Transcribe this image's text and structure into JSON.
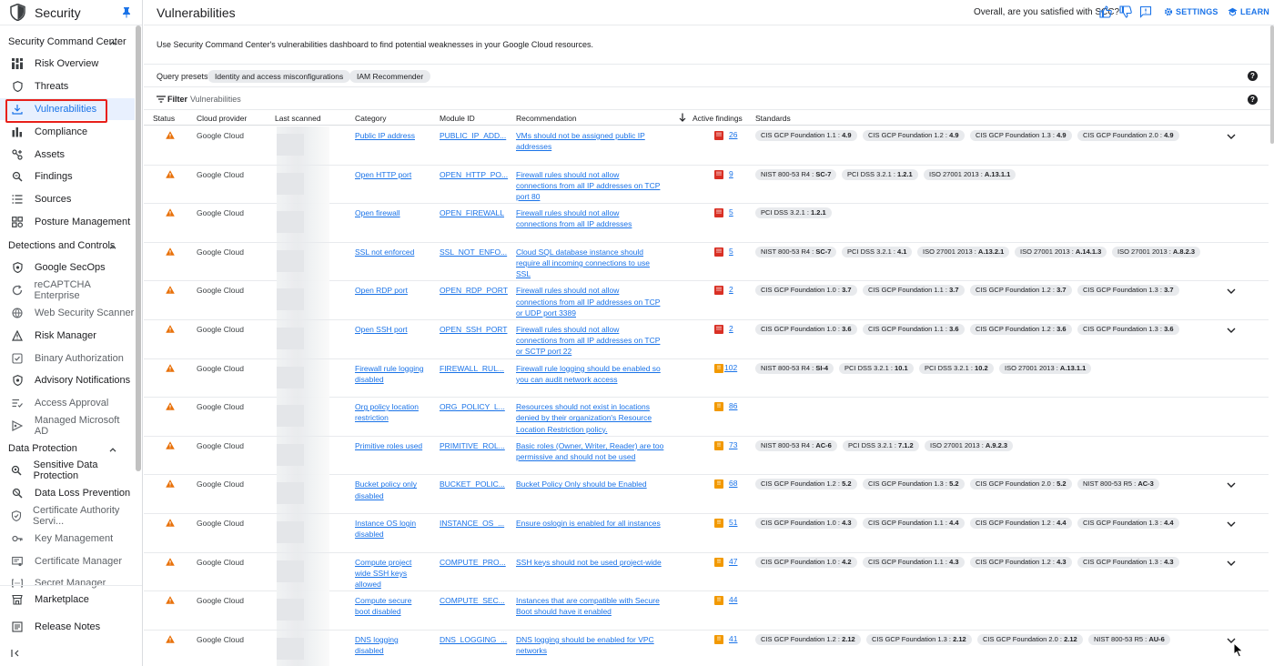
{
  "sidebar": {
    "title": "Security",
    "sections": [
      {
        "label": "Security Command Center",
        "items": [
          {
            "label": "Risk Overview",
            "icon": "grid-icon",
            "dim": false
          },
          {
            "label": "Threats",
            "icon": "shield-outline-icon",
            "dim": false
          },
          {
            "label": "Vulnerabilities",
            "icon": "download-icon",
            "dim": false,
            "active": true
          },
          {
            "label": "Compliance",
            "icon": "bar-chart-icon",
            "dim": false
          },
          {
            "label": "Assets",
            "icon": "assets-icon",
            "dim": false
          },
          {
            "label": "Findings",
            "icon": "findings-icon",
            "dim": false
          },
          {
            "label": "Sources",
            "icon": "list-icon",
            "dim": false
          },
          {
            "label": "Posture Management",
            "icon": "posture-icon",
            "dim": false
          }
        ]
      },
      {
        "label": "Detections and Controls",
        "items": [
          {
            "label": "Google SecOps",
            "icon": "shield-icon",
            "dim": false
          },
          {
            "label": "reCAPTCHA Enterprise",
            "icon": "recaptcha-icon",
            "dim": true
          },
          {
            "label": "Web Security Scanner",
            "icon": "web-scanner-icon",
            "dim": true
          },
          {
            "label": "Risk Manager",
            "icon": "risk-manager-icon",
            "dim": false
          },
          {
            "label": "Binary Authorization",
            "icon": "binary-auth-icon",
            "dim": true
          },
          {
            "label": "Advisory Notifications",
            "icon": "shield-icon",
            "dim": false
          },
          {
            "label": "Access Approval",
            "icon": "access-approval-icon",
            "dim": true
          },
          {
            "label": "Managed Microsoft AD",
            "icon": "managed-ad-icon",
            "dim": true
          }
        ]
      },
      {
        "label": "Data Protection",
        "items": [
          {
            "label": "Sensitive Data Protection",
            "icon": "sensitive-data-icon",
            "dim": false
          },
          {
            "label": "Data Loss Prevention",
            "icon": "dlp-icon",
            "dim": false
          },
          {
            "label": "Certificate Authority Servi...",
            "icon": "cert-authority-icon",
            "dim": true
          },
          {
            "label": "Key Management",
            "icon": "key-icon",
            "dim": true
          },
          {
            "label": "Certificate Manager",
            "icon": "cert-manager-icon",
            "dim": true
          },
          {
            "label": "Secret Manager",
            "icon": "secret-icon",
            "dim": true
          }
        ]
      }
    ],
    "bottom": [
      {
        "label": "Marketplace",
        "icon": "marketplace-icon"
      },
      {
        "label": "Release Notes",
        "icon": "release-notes-icon"
      }
    ]
  },
  "header": {
    "title": "Vulnerabilities",
    "feedback": "Overall, are you satisfied with SCC?",
    "settings": "SETTINGS",
    "learn": "LEARN"
  },
  "description": "Use Security Command Center's vulnerabilities dashboard to find potential weaknesses in your Google Cloud resources.",
  "presets": {
    "label": "Query presets",
    "chips": [
      "Identity and access misconfigurations",
      "IAM Recommender"
    ]
  },
  "filter": {
    "label": "Filter",
    "placeholder": "Vulnerabilities"
  },
  "table": {
    "columns": [
      "Status",
      "Cloud provider",
      "Last scanned",
      "Category",
      "Module ID",
      "Recommendation",
      "Active findings",
      "Standards"
    ],
    "rows": [
      {
        "provider": "Google Cloud",
        "category": [
          "Public IP address"
        ],
        "module": "PUBLIC_IP_ADD...",
        "rec": [
          "VMs should not be assigned public IP",
          "addresses"
        ],
        "sev": "high",
        "count": "26",
        "standards": [
          [
            "CIS GCP Foundation 1.1",
            "4.9"
          ],
          [
            "CIS GCP Foundation 1.2",
            "4.9"
          ],
          [
            "CIS GCP Foundation 1.3",
            "4.9"
          ],
          [
            "CIS GCP Foundation 2.0",
            "4.9"
          ]
        ],
        "expand": true
      },
      {
        "provider": "Google Cloud",
        "category": [
          "Open HTTP port"
        ],
        "module": "OPEN_HTTP_PO...",
        "rec": [
          "Firewall rules should not allow",
          "connections from all IP addresses on TCP",
          "port 80"
        ],
        "sev": "high",
        "count": "9",
        "standards": [
          [
            "NIST 800-53 R4",
            "SC-7"
          ],
          [
            "PCI DSS 3.2.1",
            "1.2.1"
          ],
          [
            "ISO 27001 2013",
            "A.13.1.1"
          ]
        ],
        "expand": false
      },
      {
        "provider": "Google Cloud",
        "category": [
          "Open firewall"
        ],
        "module": "OPEN_FIREWALL",
        "rec": [
          "Firewall rules should not allow",
          "connections from all IP addresses"
        ],
        "sev": "high",
        "count": "5",
        "standards": [
          [
            "PCI DSS 3.2.1",
            "1.2.1"
          ]
        ],
        "expand": false
      },
      {
        "provider": "Google Cloud",
        "category": [
          "SSL not enforced"
        ],
        "module": "SSL_NOT_ENFO...",
        "rec": [
          "Cloud SQL database instance should",
          "require all incoming connections to use",
          "SSL"
        ],
        "sev": "high",
        "count": "5",
        "standards": [
          [
            "NIST 800-53 R4",
            "SC-7"
          ],
          [
            "PCI DSS 3.2.1",
            "4.1"
          ],
          [
            "ISO 27001 2013",
            "A.13.2.1"
          ],
          [
            "ISO 27001 2013",
            "A.14.1.3"
          ],
          [
            "ISO 27001 2013",
            "A.8.2.3"
          ]
        ],
        "expand": false
      },
      {
        "provider": "Google Cloud",
        "category": [
          "Open RDP port"
        ],
        "module": "OPEN_RDP_PORT",
        "rec": [
          "Firewall rules should not allow",
          "connections from all IP addresses on TCP",
          "or UDP port 3389"
        ],
        "sev": "high",
        "count": "2",
        "standards": [
          [
            "CIS GCP Foundation 1.0",
            "3.7"
          ],
          [
            "CIS GCP Foundation 1.1",
            "3.7"
          ],
          [
            "CIS GCP Foundation 1.2",
            "3.7"
          ],
          [
            "CIS GCP Foundation 1.3",
            "3.7"
          ]
        ],
        "expand": true
      },
      {
        "provider": "Google Cloud",
        "category": [
          "Open SSH port"
        ],
        "module": "OPEN_SSH_PORT",
        "rec": [
          "Firewall rules should not allow",
          "connections from all IP addresses on TCP",
          "or SCTP port 22"
        ],
        "sev": "high",
        "count": "2",
        "standards": [
          [
            "CIS GCP Foundation 1.0",
            "3.6"
          ],
          [
            "CIS GCP Foundation 1.1",
            "3.6"
          ],
          [
            "CIS GCP Foundation 1.2",
            "3.6"
          ],
          [
            "CIS GCP Foundation 1.3",
            "3.6"
          ]
        ],
        "expand": true
      },
      {
        "provider": "Google Cloud",
        "category": [
          "Firewall rule logging",
          "disabled"
        ],
        "module": "FIREWALL_RUL...",
        "rec": [
          "Firewall rule logging should be enabled so",
          "you can audit network access"
        ],
        "sev": "med",
        "count": "102",
        "standards": [
          [
            "NIST 800-53 R4",
            "SI-4"
          ],
          [
            "PCI DSS 3.2.1",
            "10.1"
          ],
          [
            "PCI DSS 3.2.1",
            "10.2"
          ],
          [
            "ISO 27001 2013",
            "A.13.1.1"
          ]
        ],
        "expand": false
      },
      {
        "provider": "Google Cloud",
        "category": [
          "Org policy location",
          "restriction"
        ],
        "module": "ORG_POLICY_L...",
        "rec": [
          "Resources should not exist in locations",
          "denied by their organization's Resource",
          "Location Restriction policy."
        ],
        "sev": "med",
        "count": "86",
        "standards": [],
        "expand": false
      },
      {
        "provider": "Google Cloud",
        "category": [
          "Primitive roles used"
        ],
        "module": "PRIMITIVE_ROL...",
        "rec": [
          "Basic roles (Owner, Writer, Reader) are too",
          "permissive and should not be used"
        ],
        "sev": "med",
        "count": "73",
        "standards": [
          [
            "NIST 800-53 R4",
            "AC-6"
          ],
          [
            "PCI DSS 3.2.1",
            "7.1.2"
          ],
          [
            "ISO 27001 2013",
            "A.9.2.3"
          ]
        ],
        "expand": false
      },
      {
        "provider": "Google Cloud",
        "category": [
          "Bucket policy only",
          "disabled"
        ],
        "module": "BUCKET_POLIC...",
        "rec": [
          "Bucket Policy Only should be Enabled"
        ],
        "sev": "med",
        "count": "68",
        "standards": [
          [
            "CIS GCP Foundation 1.2",
            "5.2"
          ],
          [
            "CIS GCP Foundation 1.3",
            "5.2"
          ],
          [
            "CIS GCP Foundation 2.0",
            "5.2"
          ],
          [
            "NIST 800-53 R5",
            "AC-3"
          ]
        ],
        "expand": true
      },
      {
        "provider": "Google Cloud",
        "category": [
          "Instance OS login",
          "disabled"
        ],
        "module": "INSTANCE_OS_...",
        "rec": [
          "Ensure oslogin is enabled for all instances"
        ],
        "sev": "med",
        "count": "51",
        "standards": [
          [
            "CIS GCP Foundation 1.0",
            "4.3"
          ],
          [
            "CIS GCP Foundation 1.1",
            "4.4"
          ],
          [
            "CIS GCP Foundation 1.2",
            "4.4"
          ],
          [
            "CIS GCP Foundation 1.3",
            "4.4"
          ]
        ],
        "expand": true
      },
      {
        "provider": "Google Cloud",
        "category": [
          "Compute project",
          "wide SSH keys",
          "allowed"
        ],
        "module": "COMPUTE_PRO...",
        "rec": [
          "SSH keys should not be used project-wide"
        ],
        "sev": "med",
        "count": "47",
        "standards": [
          [
            "CIS GCP Foundation 1.0",
            "4.2"
          ],
          [
            "CIS GCP Foundation 1.1",
            "4.3"
          ],
          [
            "CIS GCP Foundation 1.2",
            "4.3"
          ],
          [
            "CIS GCP Foundation 1.3",
            "4.3"
          ]
        ],
        "expand": true
      },
      {
        "provider": "Google Cloud",
        "category": [
          "Compute secure",
          "boot disabled"
        ],
        "module": "COMPUTE_SEC...",
        "rec": [
          "Instances that are compatible with Secure",
          "Boot should have it enabled"
        ],
        "sev": "med",
        "count": "44",
        "standards": [],
        "expand": false
      },
      {
        "provider": "Google Cloud",
        "category": [
          "DNS logging",
          "disabled"
        ],
        "module": "DNS_LOGGING_...",
        "rec": [
          "DNS logging should be enabled for VPC",
          "networks"
        ],
        "sev": "med",
        "count": "41",
        "standards": [
          [
            "CIS GCP Foundation 1.2",
            "2.12"
          ],
          [
            "CIS GCP Foundation 1.3",
            "2.12"
          ],
          [
            "CIS GCP Foundation 2.0",
            "2.12"
          ],
          [
            "NIST 800-53 R5",
            "AU-6"
          ]
        ],
        "expand": true
      }
    ]
  },
  "colors": {
    "accent": "#1a73e8",
    "high": "#d93025",
    "medium": "#f29900",
    "warning": "#e8710a"
  }
}
